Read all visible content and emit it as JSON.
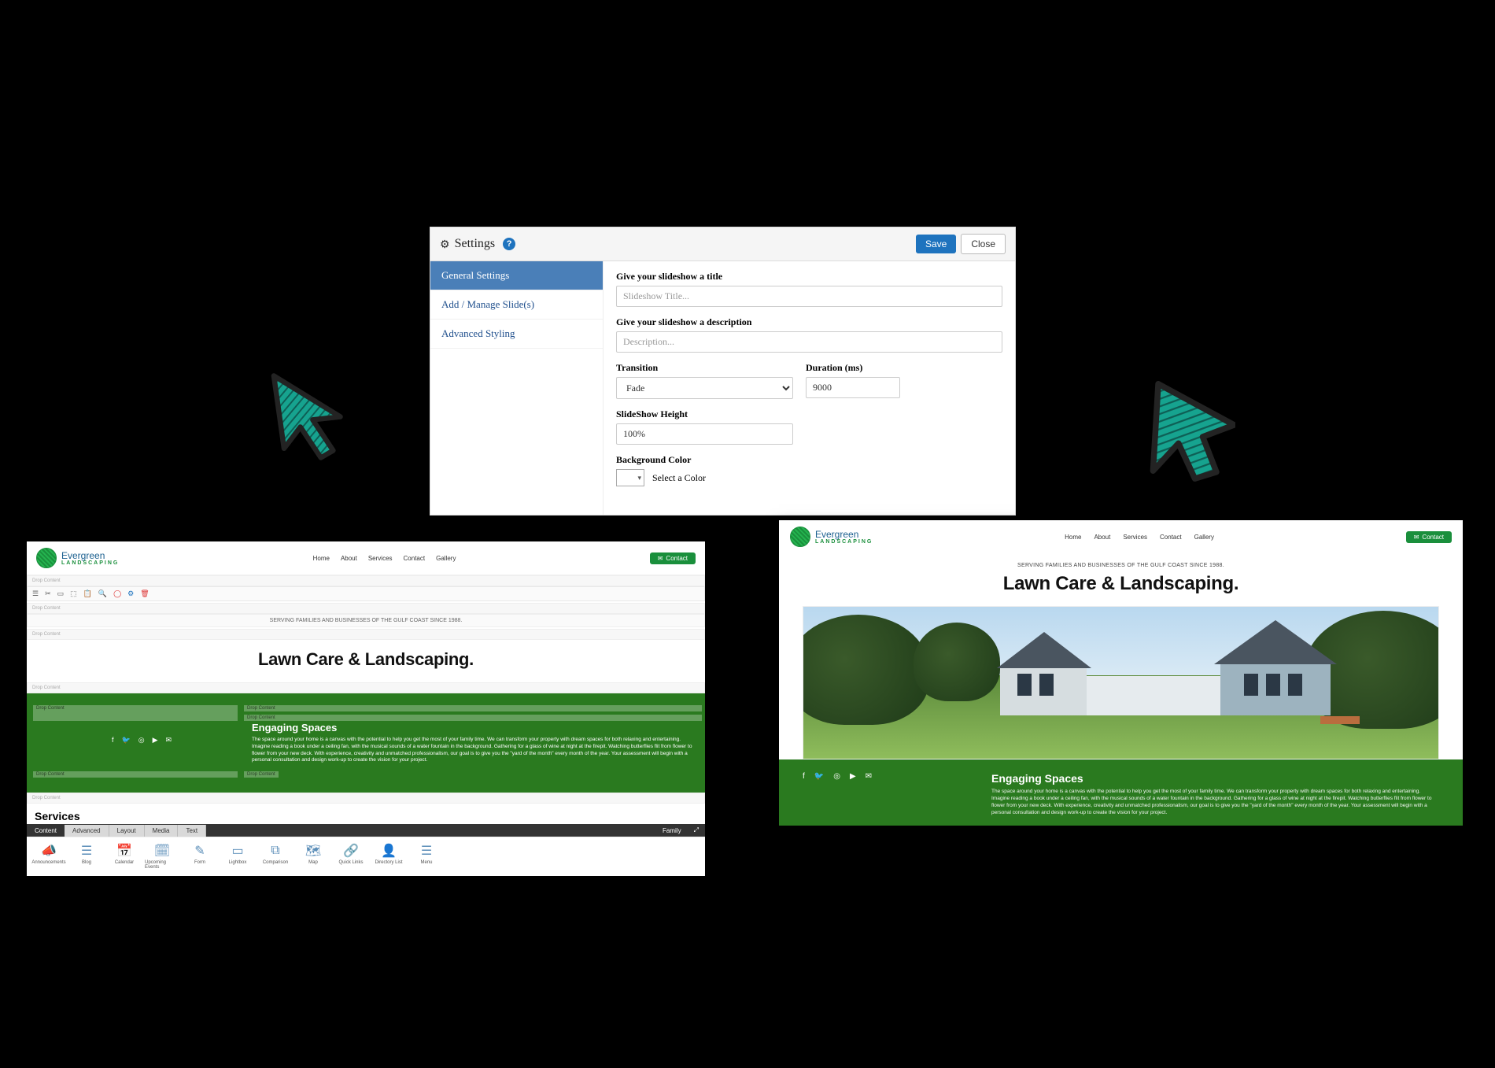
{
  "settings": {
    "title": "Settings",
    "save_label": "Save",
    "close_label": "Close",
    "tabs": {
      "general": "General Settings",
      "manage": "Add / Manage Slide(s)",
      "advanced": "Advanced Styling"
    },
    "form": {
      "title_label": "Give your slideshow a title",
      "title_placeholder": "Slideshow Title...",
      "desc_label": "Give your slideshow a description",
      "desc_placeholder": "Description...",
      "transition_label": "Transition",
      "transition_value": "Fade",
      "duration_label": "Duration (ms)",
      "duration_value": "9000",
      "height_label": "SlideShow Height",
      "height_value": "100%",
      "bgcolor_label": "Background Color",
      "bgcolor_text": "Select a Color"
    }
  },
  "brand": {
    "name": "Evergreen",
    "sub": "LANDSCAPING"
  },
  "nav": {
    "home": "Home",
    "about": "About",
    "services": "Services",
    "contact": "Contact",
    "gallery": "Gallery",
    "contact_btn": "Contact"
  },
  "editor": {
    "tagline": "SERVING FAMILIES AND BUSINESSES OF THE GULF COAST SINCE 1988.",
    "headline": "Lawn Care & Landscaping.",
    "drop_label": "Drop Content",
    "spaces_title": "Engaging Spaces",
    "spaces_body": "The space around your home is a canvas with the potential to help you get the most of your family time. We can transform your property with dream spaces for both relaxing and entertaining. Imagine reading a book under a ceiling fan, with the musical sounds of a water fountain in the background. Gathering for a glass of wine at night at the firepit. Watching butterflies flit from flower to flower from your new deck. With experience, creativity and unmatched professionalism, our goal is to give you the \"yard of the month\" every month of the year. Your assessment will begin with a personal consultation and design work-up to create the vision for your project.",
    "section_services": "Services",
    "toolbar_tabs": {
      "content": "Content",
      "advanced": "Advanced",
      "layout": "Layout",
      "media": "Media",
      "text": "Text",
      "family": "Family"
    },
    "components": {
      "announcements": "Announcements",
      "blog": "Blog",
      "calendar": "Calendar",
      "upcoming": "Upcoming Events",
      "form": "Form",
      "lightbox": "Lightbox",
      "comparison": "Comparison",
      "map": "Map",
      "quicklinks": "Quick Links",
      "directory": "Directory List",
      "menu": "Menu"
    }
  },
  "preview": {
    "tagline": "SERVING FAMILIES AND BUSINESSES OF THE GULF COAST SINCE 1988.",
    "headline": "Lawn Care & Landscaping.",
    "spaces_title": "Engaging Spaces",
    "spaces_body": "The space around your home is a canvas with the potential to help you get the most of your family time. We can transform your property with dream spaces for both relaxing and entertaining. Imagine reading a book under a ceiling fan, with the musical sounds of a water fountain in the background. Gathering for a glass of wine at night at the firepit. Watching butterflies flit from flower to flower from your new deck. With experience, creativity and unmatched professionalism, our goal is to give you the \"yard of the month\" every month of the year. Your assessment will begin with a personal consultation and design work-up to create the vision for your project."
  }
}
